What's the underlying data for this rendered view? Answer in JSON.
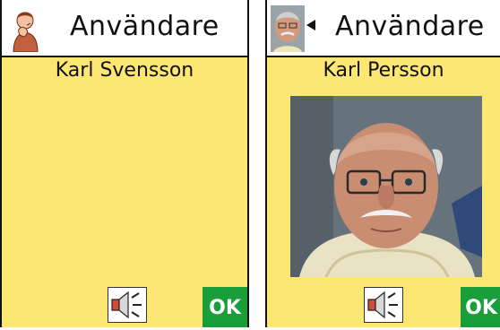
{
  "screens": [
    {
      "header": {
        "title": "Användare",
        "icon": "person-signing-icon"
      },
      "user": {
        "name": "Karl Svensson",
        "has_photo": false
      },
      "speaker_icon": "speaker-icon",
      "ok_label": "OK"
    },
    {
      "header": {
        "title": "Användare",
        "icon": "user-thumbnail-with-arrow-icon"
      },
      "user": {
        "name": "Karl Persson",
        "has_photo": true
      },
      "speaker_icon": "speaker-icon",
      "ok_label": "OK"
    }
  ],
  "colors": {
    "panel_background": "#fde774",
    "header_background": "#ffffff",
    "ok_button": "#1a9e3a",
    "border": "#111111"
  }
}
